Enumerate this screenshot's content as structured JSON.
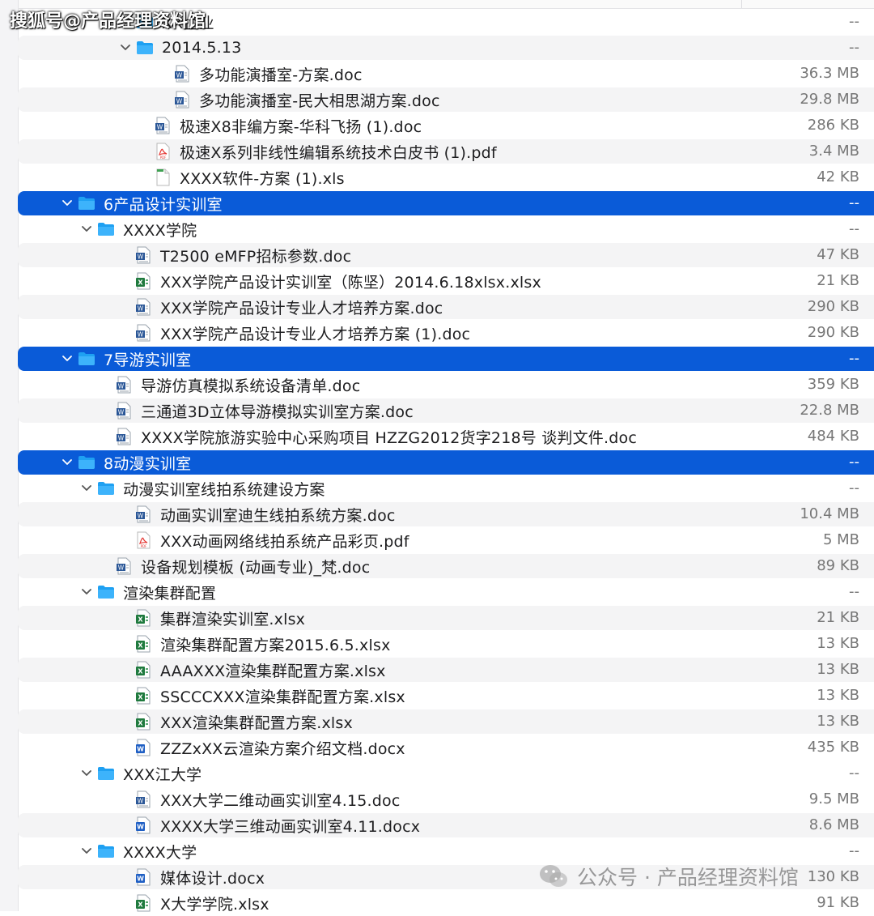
{
  "watermark_top": "搜狐号@产品经理资料馆",
  "watermark_bottom": "公众号 · 产品经理资料馆",
  "accent_color": "#0a5bd8",
  "rows": [
    {
      "type": "folder",
      "indent": 168,
      "expanded": true,
      "name": "XX企业",
      "size": "--",
      "selected": false,
      "alt": false
    },
    {
      "type": "folder",
      "indent": 168,
      "expanded": true,
      "name": "2014.5.13",
      "size": "--",
      "selected": false,
      "alt": true
    },
    {
      "type": "doc",
      "indent": 214,
      "name": "多功能演播室-方案.doc",
      "size": "36.3 MB",
      "selected": false,
      "alt": false
    },
    {
      "type": "doc",
      "indent": 214,
      "name": "多功能演播室-民大相思湖方案.doc",
      "size": "29.8 MB",
      "selected": false,
      "alt": true
    },
    {
      "type": "doc",
      "indent": 190,
      "name": "极速X8非编方案-华科飞扬 (1).doc",
      "size": "286 KB",
      "selected": false,
      "alt": false
    },
    {
      "type": "pdf",
      "indent": 190,
      "name": "极速X系列非线性编辑系统技术白皮书 (1).pdf",
      "size": "3.4 MB",
      "selected": false,
      "alt": true
    },
    {
      "type": "blank",
      "indent": 190,
      "name": "XXXX软件-方案 (1).xls",
      "size": "42 KB",
      "selected": false,
      "alt": false
    },
    {
      "type": "folder",
      "indent": 96,
      "expanded": true,
      "name": "6产品设计实训室",
      "size": "--",
      "selected": true,
      "alt": false
    },
    {
      "type": "folder",
      "indent": 120,
      "expanded": true,
      "name": "XXXX学院",
      "size": "--",
      "selected": false,
      "alt": false
    },
    {
      "type": "doc",
      "indent": 166,
      "name": "T2500 eMFP招标参数.doc",
      "size": "47 KB",
      "selected": false,
      "alt": true
    },
    {
      "type": "xls",
      "indent": 166,
      "name": "XXX学院产品设计实训室（陈坚）2014.6.18xlsx.xlsx",
      "size": "21 KB",
      "selected": false,
      "alt": false
    },
    {
      "type": "doc",
      "indent": 166,
      "name": "XXX学院产品设计专业人才培养方案.doc",
      "size": "290 KB",
      "selected": false,
      "alt": true
    },
    {
      "type": "doc",
      "indent": 166,
      "name": "XXX学院产品设计专业人才培养方案 (1).doc",
      "size": "290 KB",
      "selected": false,
      "alt": false
    },
    {
      "type": "folder",
      "indent": 96,
      "expanded": true,
      "name": "7导游实训室",
      "size": "--",
      "selected": true,
      "alt": false
    },
    {
      "type": "doc",
      "indent": 142,
      "name": "导游仿真模拟系统设备清单.doc",
      "size": "359 KB",
      "selected": false,
      "alt": false
    },
    {
      "type": "doc",
      "indent": 142,
      "name": "三通道3D立体导游模拟实训室方案.doc",
      "size": "22.8 MB",
      "selected": false,
      "alt": true
    },
    {
      "type": "doc",
      "indent": 142,
      "name": "XXXX学院旅游实验中心采购项目 HZZG2012货字218号 谈判文件.doc",
      "size": "484 KB",
      "selected": false,
      "alt": false
    },
    {
      "type": "folder",
      "indent": 96,
      "expanded": true,
      "name": "8动漫实训室",
      "size": "--",
      "selected": true,
      "alt": false
    },
    {
      "type": "folder",
      "indent": 120,
      "expanded": true,
      "name": "动漫实训室线拍系统建设方案",
      "size": "--",
      "selected": false,
      "alt": false
    },
    {
      "type": "doc",
      "indent": 166,
      "name": "动画实训室迪生线拍系统方案.doc",
      "size": "10.4 MB",
      "selected": false,
      "alt": true
    },
    {
      "type": "pdf",
      "indent": 166,
      "name": "XXX动画网络线拍系统产品彩页.pdf",
      "size": "5 MB",
      "selected": false,
      "alt": false
    },
    {
      "type": "doc",
      "indent": 142,
      "name": "设备规划模板 (动画专业)_梵.doc",
      "size": "89 KB",
      "selected": false,
      "alt": true
    },
    {
      "type": "folder",
      "indent": 120,
      "expanded": true,
      "name": "渲染集群配置",
      "size": "--",
      "selected": false,
      "alt": false
    },
    {
      "type": "xls",
      "indent": 166,
      "name": "集群渲染实训室.xlsx",
      "size": "21 KB",
      "selected": false,
      "alt": true
    },
    {
      "type": "xls",
      "indent": 166,
      "name": "渲染集群配置方案2015.6.5.xlsx",
      "size": "13 KB",
      "selected": false,
      "alt": false
    },
    {
      "type": "xls",
      "indent": 166,
      "name": "AAAXXX渲染集群配置方案.xlsx",
      "size": "13 KB",
      "selected": false,
      "alt": true
    },
    {
      "type": "xls",
      "indent": 166,
      "name": "SSCCCXXX渲染集群配置方案.xlsx",
      "size": "13 KB",
      "selected": false,
      "alt": false
    },
    {
      "type": "xls",
      "indent": 166,
      "name": "XXX渲染集群配置方案.xlsx",
      "size": "13 KB",
      "selected": false,
      "alt": true
    },
    {
      "type": "docx",
      "indent": 166,
      "name": "ZZZxXX云渲染方案介绍文档.docx",
      "size": "435 KB",
      "selected": false,
      "alt": false
    },
    {
      "type": "folder",
      "indent": 120,
      "expanded": true,
      "name": "XXX江大学",
      "size": "--",
      "selected": false,
      "alt": false
    },
    {
      "type": "doc",
      "indent": 166,
      "name": "XXX大学二维动画实训室4.15.doc",
      "size": "9.5 MB",
      "selected": false,
      "alt": false
    },
    {
      "type": "docx",
      "indent": 166,
      "name": "XXXX大学三维动画实训室4.11.docx",
      "size": "8.6 MB",
      "selected": false,
      "alt": true
    },
    {
      "type": "folder",
      "indent": 120,
      "expanded": true,
      "name": "XXXX大学",
      "size": "--",
      "selected": false,
      "alt": false
    },
    {
      "type": "docx",
      "indent": 166,
      "name": "媒体设计.docx",
      "size": "130 KB",
      "selected": false,
      "alt": true
    },
    {
      "type": "xls",
      "indent": 166,
      "name": "X大学学院.xlsx",
      "size": "91 KB",
      "selected": false,
      "alt": false
    }
  ]
}
